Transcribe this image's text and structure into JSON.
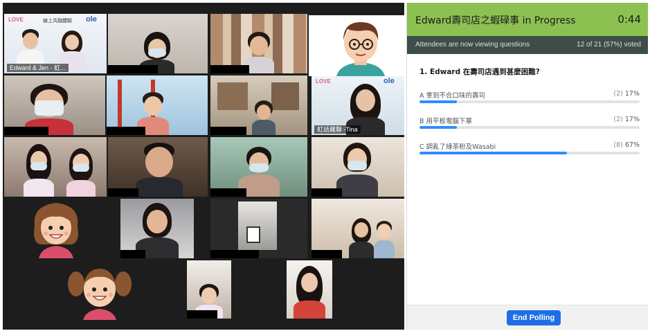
{
  "gallery": {
    "tiles": [
      {
        "label": "Edward & Jen - 虹..."
      },
      {
        "label": ""
      },
      {
        "label": ""
      },
      {
        "label": ""
      },
      {
        "label": ""
      },
      {
        "label": ""
      },
      {
        "label": "虹話雞聯 -Tina"
      }
    ],
    "logo_text": "ole",
    "logo_small": "LOVE",
    "banner_text": "線上共融體驗"
  },
  "poll": {
    "title": "Edward壽司店之蝦碌事  in Progress",
    "timer": "0:44",
    "status": "Attendees are now viewing questions",
    "vote_count": "12 of 21 (57%) voted",
    "question": "1. Edward 在壽司店遇到甚麼困難?",
    "answers": [
      {
        "label": "A 拿到不合口味的壽司",
        "count": "(2)",
        "percent": "17%",
        "value": 17
      },
      {
        "label": "B 用平板電腦下單",
        "count": "(2)",
        "percent": "17%",
        "value": 17
      },
      {
        "label": "C 調亂了綠茶粉及Wasabi",
        "count": "(8)",
        "percent": "67%",
        "value": 67
      }
    ],
    "end_button": "End Polling"
  },
  "colors": {
    "header_green": "#8cc152",
    "status_bar": "#3e4d47",
    "bar_blue": "#2d8cff",
    "button_blue": "#1f6ee6",
    "active_outline": "#9be35a"
  }
}
